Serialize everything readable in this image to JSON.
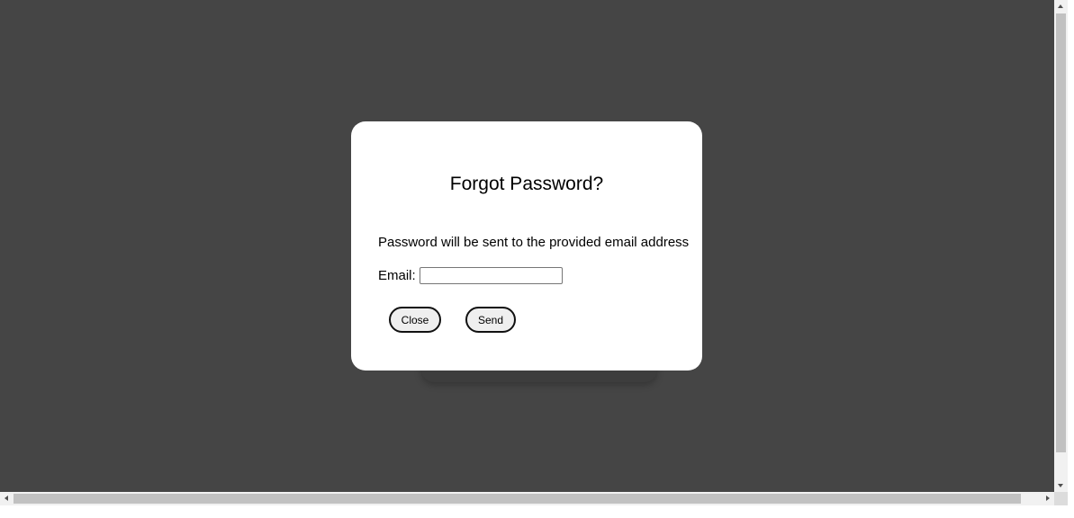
{
  "modal": {
    "title": "Forgot Password?",
    "message": "Password will be sent to the provided email address",
    "email_label": "Email:",
    "email_value": "",
    "email_placeholder": "",
    "close_label": "Close",
    "send_label": "Send"
  },
  "colors": {
    "overlay_background": "#454545",
    "modal_background": "#ffffff",
    "button_background": "#efefef",
    "button_border": "#111111"
  }
}
